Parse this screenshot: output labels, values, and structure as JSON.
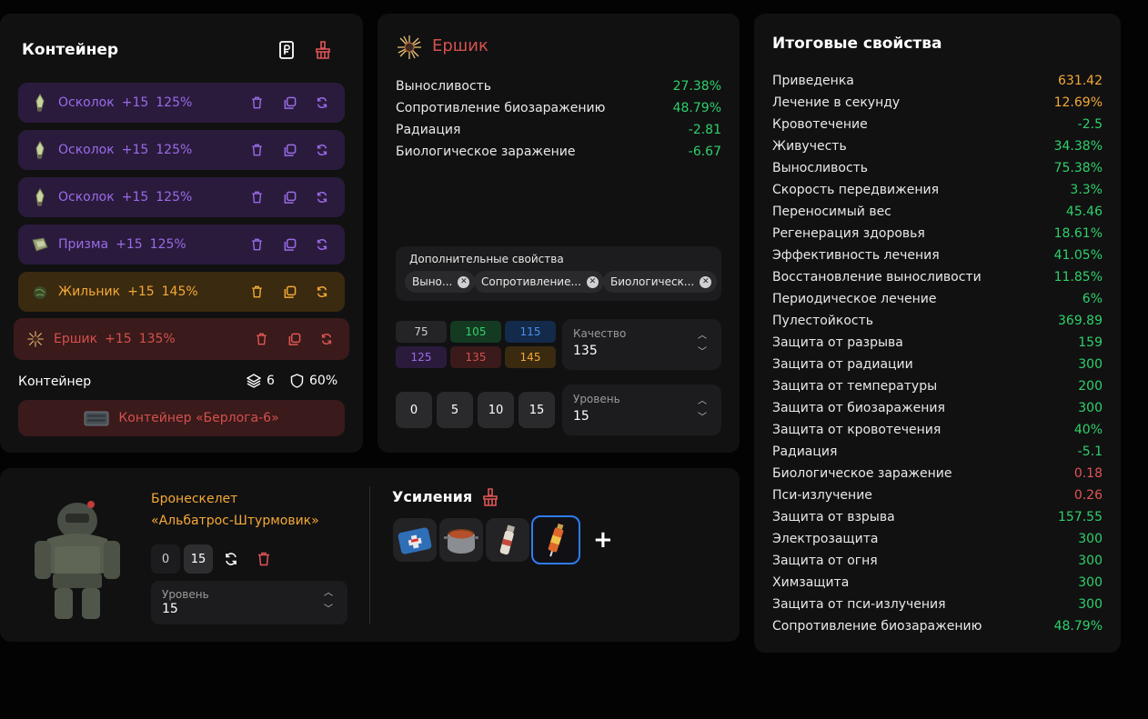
{
  "colors": {
    "green": "#2fd06a",
    "orange": "#f4a935",
    "red": "#e05555",
    "purple": "#9a6be6",
    "blue_accent": "#2f7cf0"
  },
  "container": {
    "title": "Контейнер",
    "header_icons": [
      "ruble-document-icon",
      "broom-icon"
    ],
    "rows": [
      {
        "name": "Осколок",
        "plus": "+15",
        "percent": "125%",
        "rarity": "purple",
        "icon": "shard-icon"
      },
      {
        "name": "Осколок",
        "plus": "+15",
        "percent": "125%",
        "rarity": "purple",
        "icon": "shard-icon"
      },
      {
        "name": "Осколок",
        "plus": "+15",
        "percent": "125%",
        "rarity": "purple",
        "icon": "shard-icon"
      },
      {
        "name": "Призма",
        "plus": "+15",
        "percent": "125%",
        "rarity": "purple",
        "icon": "prism-icon"
      },
      {
        "name": "Жильник",
        "plus": "+15",
        "percent": "145%",
        "rarity": "orange",
        "icon": "vein-icon"
      },
      {
        "name": "Ершик",
        "plus": "+15",
        "percent": "135%",
        "rarity": "red",
        "icon": "ershik-icon"
      }
    ],
    "row_actions": [
      "trash-icon",
      "copy-icon",
      "refresh-icon"
    ],
    "footer_label": "Контейнер",
    "slots": "6",
    "protection": "60%",
    "container_button": "Контейнер «Берлога-6»"
  },
  "artifact": {
    "title": "Ершик",
    "properties": [
      {
        "name": "Выносливость",
        "value": "27.38%"
      },
      {
        "name": "Сопротивление биозаражению",
        "value": "48.79%"
      },
      {
        "name": "Радиация",
        "value": "-2.81"
      },
      {
        "name": "Биологическое заражение",
        "value": "-6.67"
      }
    ],
    "additional_label": "Дополнительные свойства",
    "chips": [
      "Выно...",
      "Сопротивление...",
      "Биологическ..."
    ],
    "quality_values": [
      "75",
      "105",
      "115",
      "125",
      "135",
      "145"
    ],
    "quality_select": {
      "label": "Качество",
      "value": "135"
    },
    "level_buttons": [
      "0",
      "5",
      "10",
      "15"
    ],
    "level_select": {
      "label": "Уровень",
      "value": "15"
    }
  },
  "armor": {
    "name_line1": "Бронескелет",
    "name_line2": "«Альбатрос-Штурмовик»",
    "level_buttons": [
      "0",
      "15"
    ],
    "level_select": {
      "label": "Уровень",
      "value": "15"
    },
    "boosts_title": "Усиления",
    "boosts": [
      "medkit-icon",
      "stew-pot-icon",
      "pill-bottle-icon",
      "syringe-icon"
    ],
    "add_label": "+"
  },
  "summary": {
    "title": "Итоговые свойства",
    "rows": [
      {
        "name": "Приведенка",
        "value": "631.42",
        "color": "orange"
      },
      {
        "name": "Лечение в секунду",
        "value": "12.69%",
        "color": "orange"
      },
      {
        "name": "Кровотечение",
        "value": "-2.5",
        "color": "green"
      },
      {
        "name": "Живучесть",
        "value": "34.38%",
        "color": "green"
      },
      {
        "name": "Выносливость",
        "value": "75.38%",
        "color": "green"
      },
      {
        "name": "Скорость передвижения",
        "value": "3.3%",
        "color": "green"
      },
      {
        "name": "Переносимый вес",
        "value": "45.46",
        "color": "green"
      },
      {
        "name": "Регенерация здоровья",
        "value": "18.61%",
        "color": "green"
      },
      {
        "name": "Эффективность лечения",
        "value": "41.05%",
        "color": "green"
      },
      {
        "name": "Восстановление выносливости",
        "value": "11.85%",
        "color": "green"
      },
      {
        "name": "Периодическое лечение",
        "value": "6%",
        "color": "green"
      },
      {
        "name": "Пулестойкость",
        "value": "369.89",
        "color": "green"
      },
      {
        "name": "Защита от разрыва",
        "value": "159",
        "color": "green"
      },
      {
        "name": "Защита от радиации",
        "value": "300",
        "color": "green"
      },
      {
        "name": "Защита от температуры",
        "value": "200",
        "color": "green"
      },
      {
        "name": "Защита от биозаражения",
        "value": "300",
        "color": "green"
      },
      {
        "name": "Защита от кровотечения",
        "value": "40%",
        "color": "green"
      },
      {
        "name": "Радиация",
        "value": "-5.1",
        "color": "green"
      },
      {
        "name": "Биологическое заражение",
        "value": "0.18",
        "color": "red"
      },
      {
        "name": "Пси-излучение",
        "value": "0.26",
        "color": "red"
      },
      {
        "name": "Защита от взрыва",
        "value": "157.55",
        "color": "green"
      },
      {
        "name": "Электрозащита",
        "value": "300",
        "color": "green"
      },
      {
        "name": "Защита от огня",
        "value": "300",
        "color": "green"
      },
      {
        "name": "Химзащита",
        "value": "300",
        "color": "green"
      },
      {
        "name": "Защита от пси-излучения",
        "value": "300",
        "color": "green"
      },
      {
        "name": "Сопротивление биозаражению",
        "value": "48.79%",
        "color": "green"
      }
    ]
  }
}
